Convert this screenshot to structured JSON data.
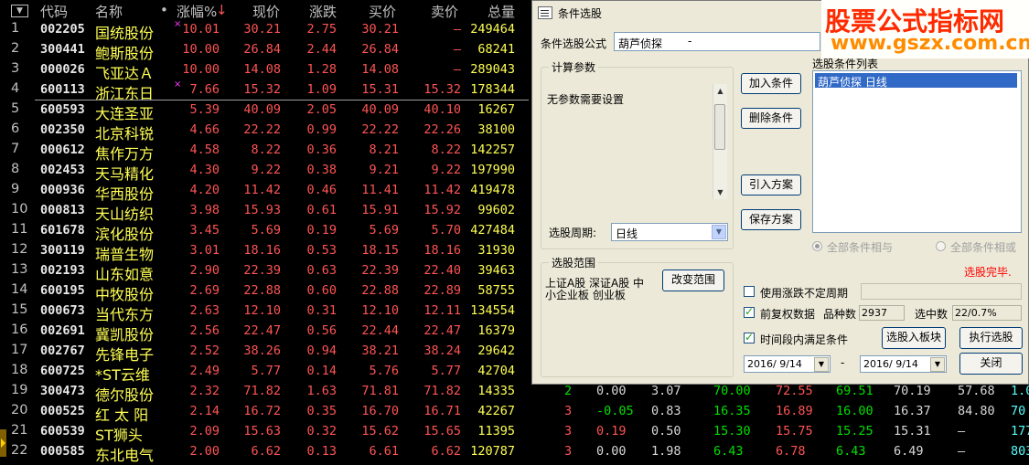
{
  "header": {
    "menu_glyph": "▼",
    "code": "代码",
    "name": "名称",
    "dot": "•",
    "pct": "涨幅%",
    "pct_arrow": "↓",
    "price": "现价",
    "chg": "涨跌",
    "bid": "买价",
    "ask": "卖价",
    "vol": "总量"
  },
  "rows": [
    {
      "idx": "1",
      "code": "002205",
      "name": "国统股份",
      "mark": "×",
      "pct": "10.01",
      "price": "30.21",
      "chg": "2.75",
      "bid": "30.21",
      "ask": "—",
      "vol": "249464"
    },
    {
      "idx": "2",
      "code": "300441",
      "name": "鲍斯股份",
      "mark": "",
      "pct": "10.00",
      "price": "26.84",
      "chg": "2.44",
      "bid": "26.84",
      "ask": "—",
      "vol": "68241"
    },
    {
      "idx": "3",
      "code": "000026",
      "name": "飞亚达Ａ",
      "mark": "",
      "pct": "10.00",
      "price": "14.08",
      "chg": "1.28",
      "bid": "14.08",
      "ask": "—",
      "vol": "289043"
    },
    {
      "idx": "4",
      "code": "600113",
      "name": "浙江东日",
      "mark": "×",
      "pct": "7.66",
      "price": "15.32",
      "chg": "1.09",
      "bid": "15.31",
      "ask": "15.32",
      "vol": "178344"
    },
    {
      "idx": "5",
      "code": "600593",
      "name": "大连圣亚",
      "mark": "",
      "pct": "5.39",
      "price": "40.09",
      "chg": "2.05",
      "bid": "40.09",
      "ask": "40.10",
      "vol": "16267"
    },
    {
      "idx": "6",
      "code": "002350",
      "name": "北京科锐",
      "mark": "",
      "pct": "4.66",
      "price": "22.22",
      "chg": "0.99",
      "bid": "22.22",
      "ask": "22.26",
      "vol": "38100"
    },
    {
      "idx": "7",
      "code": "000612",
      "name": "焦作万方",
      "mark": "",
      "pct": "4.58",
      "price": "8.22",
      "chg": "0.36",
      "bid": "8.21",
      "ask": "8.22",
      "vol": "142257"
    },
    {
      "idx": "8",
      "code": "002453",
      "name": "天马精化",
      "mark": "",
      "pct": "4.30",
      "price": "9.22",
      "chg": "0.38",
      "bid": "9.21",
      "ask": "9.22",
      "vol": "197990"
    },
    {
      "idx": "9",
      "code": "000936",
      "name": "华西股份",
      "mark": "",
      "pct": "4.20",
      "price": "11.42",
      "chg": "0.46",
      "bid": "11.41",
      "ask": "11.42",
      "vol": "419478"
    },
    {
      "idx": "10",
      "code": "000813",
      "name": "天山纺织",
      "mark": "",
      "pct": "3.98",
      "price": "15.93",
      "chg": "0.61",
      "bid": "15.91",
      "ask": "15.92",
      "vol": "99602"
    },
    {
      "idx": "11",
      "code": "601678",
      "name": "滨化股份",
      "mark": "",
      "pct": "3.45",
      "price": "5.69",
      "chg": "0.19",
      "bid": "5.69",
      "ask": "5.70",
      "vol": "427484"
    },
    {
      "idx": "12",
      "code": "300119",
      "name": "瑞普生物",
      "mark": "",
      "pct": "3.01",
      "price": "18.16",
      "chg": "0.53",
      "bid": "18.15",
      "ask": "18.16",
      "vol": "31930"
    },
    {
      "idx": "13",
      "code": "002193",
      "name": "山东如意",
      "mark": "",
      "pct": "2.90",
      "price": "22.39",
      "chg": "0.63",
      "bid": "22.39",
      "ask": "22.40",
      "vol": "39463"
    },
    {
      "idx": "14",
      "code": "600195",
      "name": "中牧股份",
      "mark": "",
      "pct": "2.69",
      "price": "22.88",
      "chg": "0.60",
      "bid": "22.88",
      "ask": "22.89",
      "vol": "58755"
    },
    {
      "idx": "15",
      "code": "000673",
      "name": "当代东方",
      "mark": "",
      "pct": "2.63",
      "price": "12.10",
      "chg": "0.31",
      "bid": "12.10",
      "ask": "12.11",
      "vol": "134554"
    },
    {
      "idx": "16",
      "code": "002691",
      "name": "冀凯股份",
      "mark": "",
      "pct": "2.56",
      "price": "22.47",
      "chg": "0.56",
      "bid": "22.44",
      "ask": "22.47",
      "vol": "16379"
    },
    {
      "idx": "17",
      "code": "002767",
      "name": "先锋电子",
      "mark": "",
      "pct": "2.52",
      "price": "38.26",
      "chg": "0.94",
      "bid": "38.21",
      "ask": "38.24",
      "vol": "29642"
    },
    {
      "idx": "18",
      "code": "600725",
      "name": "*ST云维",
      "mark": "",
      "pct": "2.49",
      "price": "5.77",
      "chg": "0.14",
      "bid": "5.76",
      "ask": "5.77",
      "vol": "42704"
    },
    {
      "idx": "19",
      "code": "300473",
      "name": "德尔股份",
      "mark": "",
      "pct": "2.32",
      "price": "71.82",
      "chg": "1.63",
      "bid": "71.81",
      "ask": "71.82",
      "vol": "14335",
      "ext": [
        "2",
        "0.00",
        "3.07",
        "70.00",
        "72.55",
        "69.51",
        "70.19",
        "57.68",
        "1.0"
      ]
    },
    {
      "idx": "20",
      "code": "000525",
      "name": "红 太 阳",
      "mark": "",
      "pct": "2.14",
      "price": "16.72",
      "chg": "0.35",
      "bid": "16.70",
      "ask": "16.71",
      "vol": "42267",
      "ext": [
        "3",
        "-0.05",
        "0.83",
        "16.35",
        "16.89",
        "16.00",
        "16.37",
        "84.80",
        "70"
      ]
    },
    {
      "idx": "21",
      "code": "600539",
      "name": "ST狮头",
      "mark": "",
      "pct": "2.09",
      "price": "15.63",
      "chg": "0.32",
      "bid": "15.62",
      "ask": "15.65",
      "vol": "11395",
      "ext": [
        "3",
        "0.19",
        "0.50",
        "15.30",
        "15.75",
        "15.25",
        "15.31",
        "—",
        "177"
      ]
    },
    {
      "idx": "22",
      "code": "000585",
      "name": "东北电气",
      "mark": "",
      "pct": "2.00",
      "price": "6.62",
      "chg": "0.13",
      "bid": "6.61",
      "ask": "6.62",
      "vol": "120787",
      "ext": [
        "3",
        "0.00",
        "1.98",
        "6.43",
        "6.78",
        "6.43",
        "6.49",
        "—",
        "803"
      ]
    }
  ],
  "dialog": {
    "title": "条件选股",
    "formula_label": "条件选股公式",
    "formula_value": "葫芦侦探",
    "formula_suffix": "-",
    "params_group": "计算参数",
    "params_text": "无参数需要设置",
    "period_label": "选股周期:",
    "period_value": "日线",
    "range_group": "选股范围",
    "range_text_1": "上证A股 深证A股 中",
    "range_text_2": "小企业板 创业板",
    "change_range_btn": "改变范围",
    "add_cond_btn": "加入条件",
    "del_cond_btn": "删除条件",
    "import_btn": "引入方案",
    "save_btn": "保存方案",
    "list_label": "选股条件列表",
    "list_items": [
      "葫芦侦探  日线"
    ],
    "radio_and": "全部条件相与",
    "radio_or": "全部条件相或",
    "status": "选股完毕.",
    "opt_uncertain": "使用涨跌不定周期",
    "opt_fq": "前复权数据",
    "count_label": "品种数",
    "count_value": "2937",
    "selected_label": "选中数",
    "selected_value": "22/0.7%",
    "opt_period": "时间段内满足条件",
    "to_block_btn": "选股入板块",
    "exec_btn": "执行选股",
    "date_from": "2016/ 9/14",
    "date_sep": "-",
    "date_to": "2016/ 9/14",
    "close_btn": "关闭"
  },
  "watermark": {
    "line1": "股票公式指标网",
    "line2": "www.gszx.com.cn"
  },
  "colors": {
    "up": "#ff5454",
    "name": "#ffff54",
    "volume": "#ffff54",
    "dialog_bg": "#ece9d8",
    "selection": "#3169c6"
  }
}
